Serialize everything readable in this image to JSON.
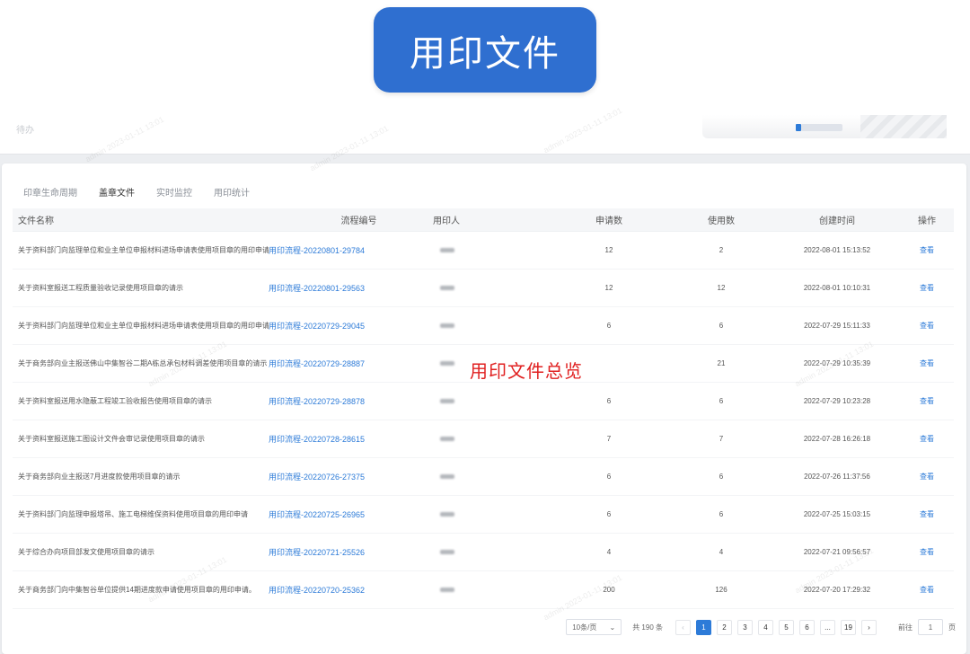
{
  "banner": {
    "title": "用印文件"
  },
  "top_panel": {
    "faint_text": "待办"
  },
  "tabs": [
    {
      "label": "印章生命周期"
    },
    {
      "label": "盖章文件"
    },
    {
      "label": "实时监控"
    },
    {
      "label": "用印统计"
    }
  ],
  "table": {
    "headers": {
      "name": "文件名称",
      "flow": "流程编号",
      "user": "用印人",
      "apply": "申请数",
      "used": "使用数",
      "time": "创建时间",
      "op": "操作"
    },
    "rows": [
      {
        "name": "关于资料部门向监理单位和业主单位申报材料进场申请表使用项目章的用印申请",
        "flow": "用印流程-20220801-29784",
        "apply": "12",
        "used": "2",
        "time": "2022-08-01 15:13:52",
        "op": "查看"
      },
      {
        "name": "关于资料室报送工程质量验收记录使用项目章的请示",
        "flow": "用印流程-20220801-29563",
        "apply": "12",
        "used": "12",
        "time": "2022-08-01 10:10:31",
        "op": "查看"
      },
      {
        "name": "关于资料部门向监理单位和业主单位申报材料进场申请表使用项目章的用印申请",
        "flow": "用印流程-20220729-29045",
        "apply": "6",
        "used": "6",
        "time": "2022-07-29 15:11:33",
        "op": "查看"
      },
      {
        "name": "关于商务部向业主报送佛山中集智谷二期A栋总承包材料调差使用项目章的请示",
        "flow": "用印流程-20220729-28887",
        "apply": "",
        "used": "21",
        "time": "2022-07-29 10:35:39",
        "op": "查看"
      },
      {
        "name": "关于资料室报送用水隐蔽工程竣工验收报告使用项目章的请示",
        "flow": "用印流程-20220729-28878",
        "apply": "6",
        "used": "6",
        "time": "2022-07-29 10:23:28",
        "op": "查看"
      },
      {
        "name": "关于资料室报送施工图设计文件会审记录使用项目章的请示",
        "flow": "用印流程-20220728-28615",
        "apply": "7",
        "used": "7",
        "time": "2022-07-28 16:26:18",
        "op": "查看"
      },
      {
        "name": "关于商务部向业主报送7月进度款使用项目章的请示",
        "flow": "用印流程-20220726-27375",
        "apply": "6",
        "used": "6",
        "time": "2022-07-26 11:37:56",
        "op": "查看"
      },
      {
        "name": "关于资料部门向监理申报塔吊、施工电梯维保资料使用项目章的用印申请",
        "flow": "用印流程-20220725-26965",
        "apply": "6",
        "used": "6",
        "time": "2022-07-25 15:03:15",
        "op": "查看"
      },
      {
        "name": "关于综合办向项目部发文使用项目章的请示",
        "flow": "用印流程-20220721-25526",
        "apply": "4",
        "used": "4",
        "time": "2022-07-21 09:56:57",
        "op": "查看"
      },
      {
        "name": "关于商务部门向中集智谷单位提供14期进度款申请使用项目章的用印申请。",
        "flow": "用印流程-20220720-25362",
        "apply": "200",
        "used": "126",
        "time": "2022-07-20 17:29:32",
        "op": "查看"
      }
    ]
  },
  "overlay_caption": "用印文件总览",
  "watermark": "admin 2023-01-11 13:01",
  "pagination": {
    "page_size": "10条/页",
    "total": "共 190 条",
    "pages": [
      "1",
      "2",
      "3",
      "4",
      "5",
      "6",
      "...",
      "19"
    ],
    "current": "1",
    "goto_label": "前往",
    "goto_value": "1",
    "page_unit": "页",
    "prev": "‹",
    "next": "›"
  },
  "colors": {
    "accent": "#2d7bd8",
    "banner": "#2f6fd0",
    "caption": "#e02020"
  }
}
